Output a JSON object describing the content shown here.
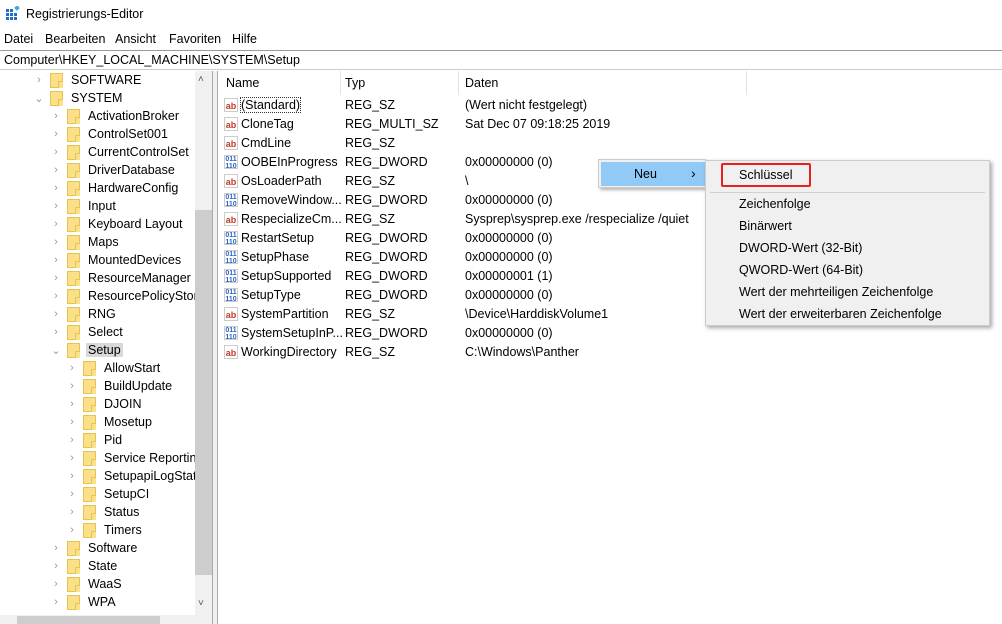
{
  "window": {
    "title": "Registrierungs-Editor",
    "icon": "registry-editor-icon"
  },
  "menu": [
    "Datei",
    "Bearbeiten",
    "Ansicht",
    "Favoriten",
    "Hilfe"
  ],
  "address": "Computer\\HKEY_LOCAL_MACHINE\\SYSTEM\\Setup",
  "tree": [
    {
      "label": "SOFTWARE",
      "level": 1,
      "expanded": false
    },
    {
      "label": "SYSTEM",
      "level": 1,
      "expanded": true
    },
    {
      "label": "ActivationBroker",
      "level": 2,
      "expanded": false
    },
    {
      "label": "ControlSet001",
      "level": 2,
      "expanded": false
    },
    {
      "label": "CurrentControlSet",
      "level": 2,
      "expanded": false
    },
    {
      "label": "DriverDatabase",
      "level": 2,
      "expanded": false
    },
    {
      "label": "HardwareConfig",
      "level": 2,
      "expanded": false
    },
    {
      "label": "Input",
      "level": 2,
      "expanded": false
    },
    {
      "label": "Keyboard Layout",
      "level": 2,
      "expanded": false
    },
    {
      "label": "Maps",
      "level": 2,
      "expanded": false
    },
    {
      "label": "MountedDevices",
      "level": 2,
      "expanded": false
    },
    {
      "label": "ResourceManager",
      "level": 2,
      "expanded": false
    },
    {
      "label": "ResourcePolicyStore",
      "level": 2,
      "expanded": false
    },
    {
      "label": "RNG",
      "level": 2,
      "expanded": false
    },
    {
      "label": "Select",
      "level": 2,
      "expanded": false
    },
    {
      "label": "Setup",
      "level": 2,
      "expanded": true,
      "selected": true
    },
    {
      "label": "AllowStart",
      "level": 3,
      "expanded": false
    },
    {
      "label": "BuildUpdate",
      "level": 3,
      "expanded": false
    },
    {
      "label": "DJOIN",
      "level": 3,
      "expanded": false
    },
    {
      "label": "Mosetup",
      "level": 3,
      "expanded": false
    },
    {
      "label": "Pid",
      "level": 3,
      "expanded": false
    },
    {
      "label": "Service Reporting",
      "level": 3,
      "expanded": false
    },
    {
      "label": "SetupapiLogStatu",
      "level": 3,
      "expanded": false
    },
    {
      "label": "SetupCI",
      "level": 3,
      "expanded": false
    },
    {
      "label": "Status",
      "level": 3,
      "expanded": false
    },
    {
      "label": "Timers",
      "level": 3,
      "expanded": false
    },
    {
      "label": "Software",
      "level": 2,
      "expanded": false
    },
    {
      "label": "State",
      "level": 2,
      "expanded": false
    },
    {
      "label": "WaaS",
      "level": 2,
      "expanded": false
    },
    {
      "label": "WPA",
      "level": 2,
      "expanded": false
    }
  ],
  "columns": [
    "Name",
    "Typ",
    "Daten"
  ],
  "values": [
    {
      "name": "(Standard)",
      "type": "REG_SZ",
      "data": "(Wert nicht festgelegt)",
      "icon": "string-value-icon"
    },
    {
      "name": "CloneTag",
      "type": "REG_MULTI_SZ",
      "data": "Sat Dec 07 09:18:25 2019",
      "icon": "string-value-icon"
    },
    {
      "name": "CmdLine",
      "type": "REG_SZ",
      "data": "",
      "icon": "string-value-icon"
    },
    {
      "name": "OOBEInProgress",
      "type": "REG_DWORD",
      "data": "0x00000000 (0)",
      "icon": "binary-value-icon"
    },
    {
      "name": "OsLoaderPath",
      "type": "REG_SZ",
      "data": "\\",
      "icon": "string-value-icon"
    },
    {
      "name": "RemoveWindow...",
      "type": "REG_DWORD",
      "data": "0x00000000 (0)",
      "icon": "binary-value-icon"
    },
    {
      "name": "RespecializeCm...",
      "type": "REG_SZ",
      "data": "Sysprep\\sysprep.exe /respecialize /quiet",
      "icon": "string-value-icon"
    },
    {
      "name": "RestartSetup",
      "type": "REG_DWORD",
      "data": "0x00000000 (0)",
      "icon": "binary-value-icon"
    },
    {
      "name": "SetupPhase",
      "type": "REG_DWORD",
      "data": "0x00000000 (0)",
      "icon": "binary-value-icon"
    },
    {
      "name": "SetupSupported",
      "type": "REG_DWORD",
      "data": "0x00000001 (1)",
      "icon": "binary-value-icon"
    },
    {
      "name": "SetupType",
      "type": "REG_DWORD",
      "data": "0x00000000 (0)",
      "icon": "binary-value-icon"
    },
    {
      "name": "SystemPartition",
      "type": "REG_SZ",
      "data": "\\Device\\HarddiskVolume1",
      "icon": "string-value-icon"
    },
    {
      "name": "SystemSetupInP...",
      "type": "REG_DWORD",
      "data": "0x00000000 (0)",
      "icon": "binary-value-icon"
    },
    {
      "name": "WorkingDirectory",
      "type": "REG_SZ",
      "data": "C:\\Windows\\Panther",
      "icon": "string-value-icon"
    }
  ],
  "context_menu": {
    "item": "Neu",
    "arrow": "›",
    "highlight_color": "#91c9f7"
  },
  "submenu": {
    "items": [
      "Schlüssel",
      "Zeichenfolge",
      "Binärwert",
      "DWORD-Wert (32-Bit)",
      "QWORD-Wert (64-Bit)",
      "Wert der mehrteiligen Zeichenfolge",
      "Wert der erweiterbaren Zeichenfolge"
    ],
    "highlighted": "Schlüssel",
    "highlight_border_color": "#e82020"
  }
}
